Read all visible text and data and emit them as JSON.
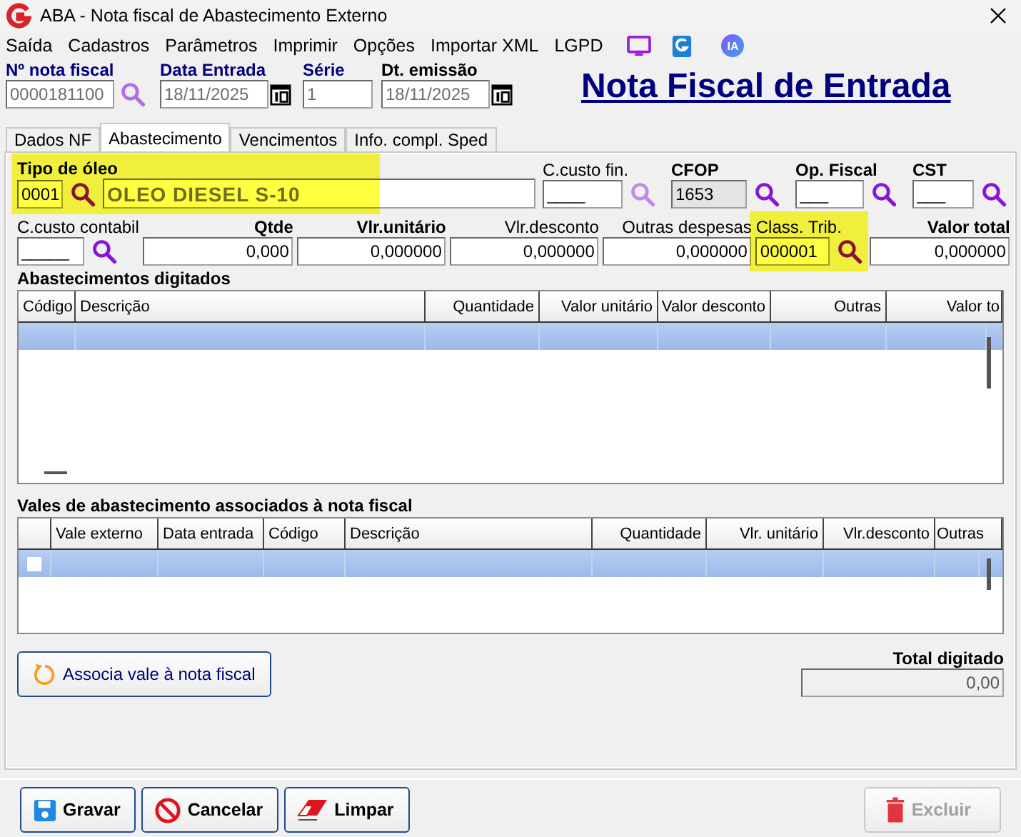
{
  "window": {
    "title": "ABA - Nota fiscal de Abastecimento Externo"
  },
  "menu": [
    "Saída",
    "Cadastros",
    "Parâmetros",
    "Imprimir",
    "Opções",
    "Importar XML",
    "LGPD"
  ],
  "menu_badge": "IA",
  "header_fields": [
    {
      "label": "Nº nota fiscal",
      "value": "0000181100",
      "kind": "lookup",
      "required": true
    },
    {
      "label": "Data Entrada",
      "value": "18/11/2025",
      "kind": "date",
      "required": true
    },
    {
      "label": "Série",
      "value": "1",
      "kind": "text",
      "required": true
    },
    {
      "label": "Dt. emissão",
      "value": "18/11/2025",
      "kind": "date",
      "required": false
    }
  ],
  "page_title": "Nota Fiscal de Entrada",
  "tabs": [
    {
      "label": "Dados NF",
      "selected": false
    },
    {
      "label": "Abastecimento",
      "selected": true
    },
    {
      "label": "Vencimentos",
      "selected": false
    },
    {
      "label": "Info. compl. Sped",
      "selected": false
    }
  ],
  "row1": [
    {
      "label": "Tipo de óleo",
      "value": "0001",
      "description": "OLEO DIESEL S-10",
      "bold": true,
      "highlighted": true,
      "disabled": false
    },
    {
      "label": "C.custo fin.",
      "value": "____",
      "bold": false,
      "highlighted": false,
      "disabled": false
    },
    {
      "label": "CFOP",
      "value": "1653",
      "bold": true,
      "highlighted": false,
      "disabled": true
    },
    {
      "label": "Op. Fiscal",
      "value": "___",
      "bold": true,
      "highlighted": false,
      "disabled": false
    },
    {
      "label": "CST",
      "value": "___",
      "bold": true,
      "highlighted": false,
      "disabled": false
    }
  ],
  "row2": [
    {
      "label": "C.custo contabil",
      "value": "_____",
      "kind": "lookup",
      "bold": false,
      "highlighted": false
    },
    {
      "label": "Qtde",
      "value": "0,000",
      "kind": "number",
      "bold": true,
      "highlighted": false
    },
    {
      "label": "Vlr.unitário",
      "value": "0,000000",
      "kind": "number",
      "bold": true,
      "highlighted": false
    },
    {
      "label": "Vlr.desconto",
      "value": "0,000000",
      "kind": "number",
      "bold": false,
      "highlighted": false
    },
    {
      "label": "Outras despesas",
      "value": "0,000000",
      "kind": "number",
      "bold": false,
      "highlighted": false
    },
    {
      "label": "Class. Trib.",
      "value": "000001",
      "kind": "lookup",
      "bold": false,
      "highlighted": true
    },
    {
      "label": "Valor total",
      "value": "0,000000",
      "kind": "number",
      "bold": true,
      "highlighted": false
    }
  ],
  "grids": [
    {
      "title": "Abastecimentos digitados",
      "columns": [
        "Código",
        "Descrição",
        "Quantidade",
        "Valor unitário",
        "Valor desconto",
        "Outras",
        "Valor to"
      ],
      "rows": [
        {
          "selected": true
        }
      ]
    },
    {
      "title": "Vales de abastecimento associados à nota fiscal",
      "columns": [
        "",
        "Vale externo",
        "Data entrada",
        "Código",
        "Descrição",
        "Quantidade",
        "Vlr. unitário",
        "Vlr.desconto",
        "Outras"
      ],
      "rows": [
        {
          "selected": true,
          "checked": false
        }
      ]
    }
  ],
  "associate_button": "Associa vale à nota fiscal",
  "total": {
    "label": "Total digitado",
    "value": "0,00"
  },
  "buttons": [
    {
      "label": "Gravar",
      "kind": "save",
      "disabled": false
    },
    {
      "label": "Cancelar",
      "kind": "cancel",
      "disabled": false
    },
    {
      "label": "Limpar",
      "kind": "clear",
      "disabled": false
    },
    {
      "label": "Excluir",
      "kind": "delete",
      "disabled": true
    }
  ]
}
